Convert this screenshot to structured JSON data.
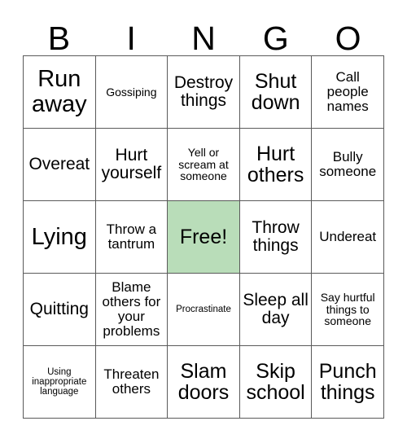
{
  "card": {
    "header_letters": [
      "B",
      "I",
      "N",
      "G",
      "O"
    ],
    "free_cell_color": "#b9ddb9",
    "border_color": "#5a5a5a",
    "text_color": "#000000",
    "background_color": "#ffffff",
    "rows": 5,
    "columns": 5,
    "cells": [
      {
        "label": "Run away",
        "size": "s-xxl",
        "free": false
      },
      {
        "label": "Gossiping",
        "size": "s-s",
        "free": false
      },
      {
        "label": "Destroy things",
        "size": "s-l",
        "free": false
      },
      {
        "label": "Shut down",
        "size": "s-xl",
        "free": false
      },
      {
        "label": "Call people names",
        "size": "s-m",
        "free": false
      },
      {
        "label": "Overeat",
        "size": "s-l",
        "free": false
      },
      {
        "label": "Hurt yourself",
        "size": "s-l",
        "free": false
      },
      {
        "label": "Yell or scream at someone",
        "size": "s-s",
        "free": false
      },
      {
        "label": "Hurt others",
        "size": "s-xl",
        "free": false
      },
      {
        "label": "Bully someone",
        "size": "s-m",
        "free": false
      },
      {
        "label": "Lying",
        "size": "s-xxl",
        "free": false
      },
      {
        "label": "Throw a tantrum",
        "size": "s-m",
        "free": false
      },
      {
        "label": "Free!",
        "size": "s-xl",
        "free": true
      },
      {
        "label": "Throw things",
        "size": "s-l",
        "free": false
      },
      {
        "label": "Undereat",
        "size": "s-m",
        "free": false
      },
      {
        "label": "Quitting",
        "size": "s-l",
        "free": false
      },
      {
        "label": "Blame others for your problems",
        "size": "s-m",
        "free": false
      },
      {
        "label": "Procrastinate",
        "size": "s-xs",
        "free": false
      },
      {
        "label": "Sleep all day",
        "size": "s-l",
        "free": false
      },
      {
        "label": "Say hurtful things to someone",
        "size": "s-s",
        "free": false
      },
      {
        "label": "Using inappropriate language",
        "size": "s-xs",
        "free": false
      },
      {
        "label": "Threaten others",
        "size": "s-m",
        "free": false
      },
      {
        "label": "Slam doors",
        "size": "s-xl",
        "free": false
      },
      {
        "label": "Skip school",
        "size": "s-xl",
        "free": false
      },
      {
        "label": "Punch things",
        "size": "s-xl",
        "free": false
      }
    ]
  }
}
